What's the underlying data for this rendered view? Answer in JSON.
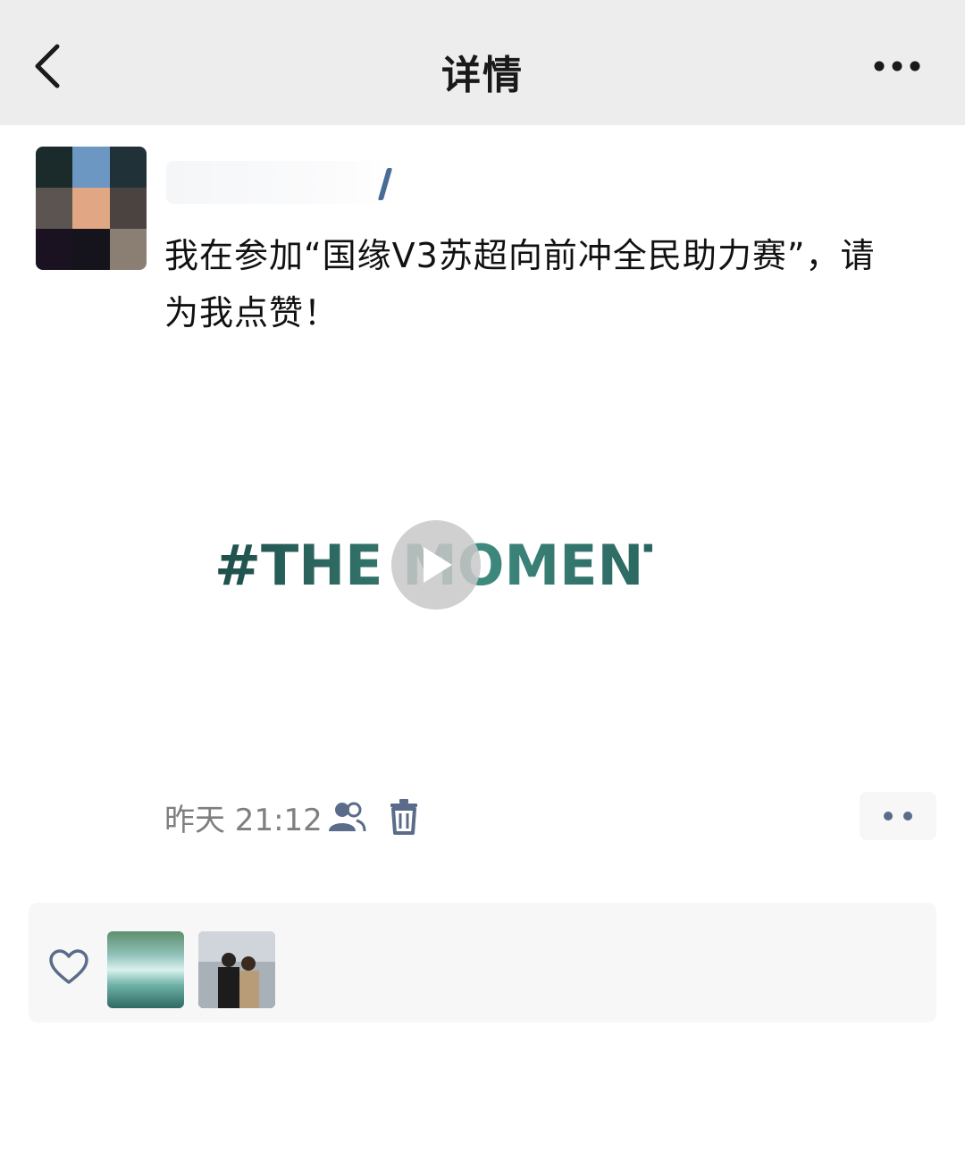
{
  "nav": {
    "title": "详情",
    "back_icon": "chevron-left-icon",
    "more_icon": "more-horizontal-icon"
  },
  "post": {
    "text": "我在参加“国缘V3苏超向前冲全民助力赛”，请为我点赞！",
    "video_caption": "#THE MOMENT",
    "time": "昨天 21:12"
  },
  "colors": {
    "nav_bg": "#ededed",
    "link_blue": "#5a6c8a",
    "likes_bg": "#f7f7f7"
  }
}
